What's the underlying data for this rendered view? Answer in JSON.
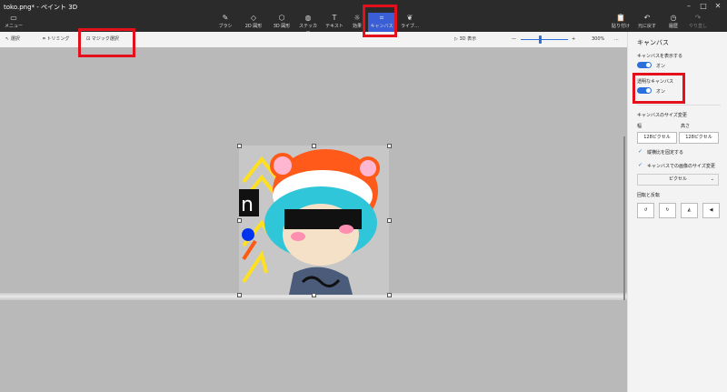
{
  "window": {
    "title": "toko.png* - ペイント 3D"
  },
  "toolbar": {
    "menu": "メニュー",
    "tools": [
      {
        "label": "ブラシ",
        "icon": "brush-icon",
        "glyph": "✎"
      },
      {
        "label": "2D 図形",
        "icon": "shape-2d-icon",
        "glyph": "◇"
      },
      {
        "label": "3D 図形",
        "icon": "shape-3d-icon",
        "glyph": "⬡"
      },
      {
        "label": "ステッカー",
        "icon": "sticker-icon",
        "glyph": "◍"
      },
      {
        "label": "テキスト",
        "icon": "text-icon",
        "glyph": "T"
      },
      {
        "label": "効果",
        "icon": "effects-icon",
        "glyph": "☼"
      },
      {
        "label": "キャンバス",
        "icon": "canvas-icon",
        "glyph": "⌗"
      },
      {
        "label": "ライブ…",
        "icon": "library-icon",
        "glyph": "❦"
      }
    ],
    "right": [
      {
        "label": "貼り付け",
        "icon": "paste-icon",
        "glyph": "📋"
      },
      {
        "label": "元に戻す",
        "icon": "undo-icon",
        "glyph": "↶"
      },
      {
        "label": "履歴",
        "icon": "history-icon",
        "glyph": "◷"
      },
      {
        "label": "やり直し",
        "icon": "redo-icon",
        "glyph": "↷"
      }
    ]
  },
  "subbar": {
    "select": "選択",
    "crop": "トリミング",
    "magic_select": "マジック選択",
    "view3d": "3D 表示",
    "zoom": "300%",
    "more": "..."
  },
  "panel": {
    "title": "キャンバス",
    "show_canvas_label": "キャンバスを表示する",
    "show_canvas_state": "オン",
    "transparent_label": "透明なキャンバス",
    "transparent_state": "オン",
    "resize_label": "キャンバスのサイズ変更",
    "width_label": "幅",
    "height_label": "高さ",
    "width_value": "128ピクセル",
    "height_value": "128ピクセル",
    "lock_aspect": "縦横比を固定する",
    "resize_image": "キャンバスでの画像のサイズ変更",
    "unit": "ピクセル",
    "rotate_flip": "回転と反転"
  },
  "colors": {
    "accent": "#3a5ed6",
    "highlight": "#e3111b"
  }
}
